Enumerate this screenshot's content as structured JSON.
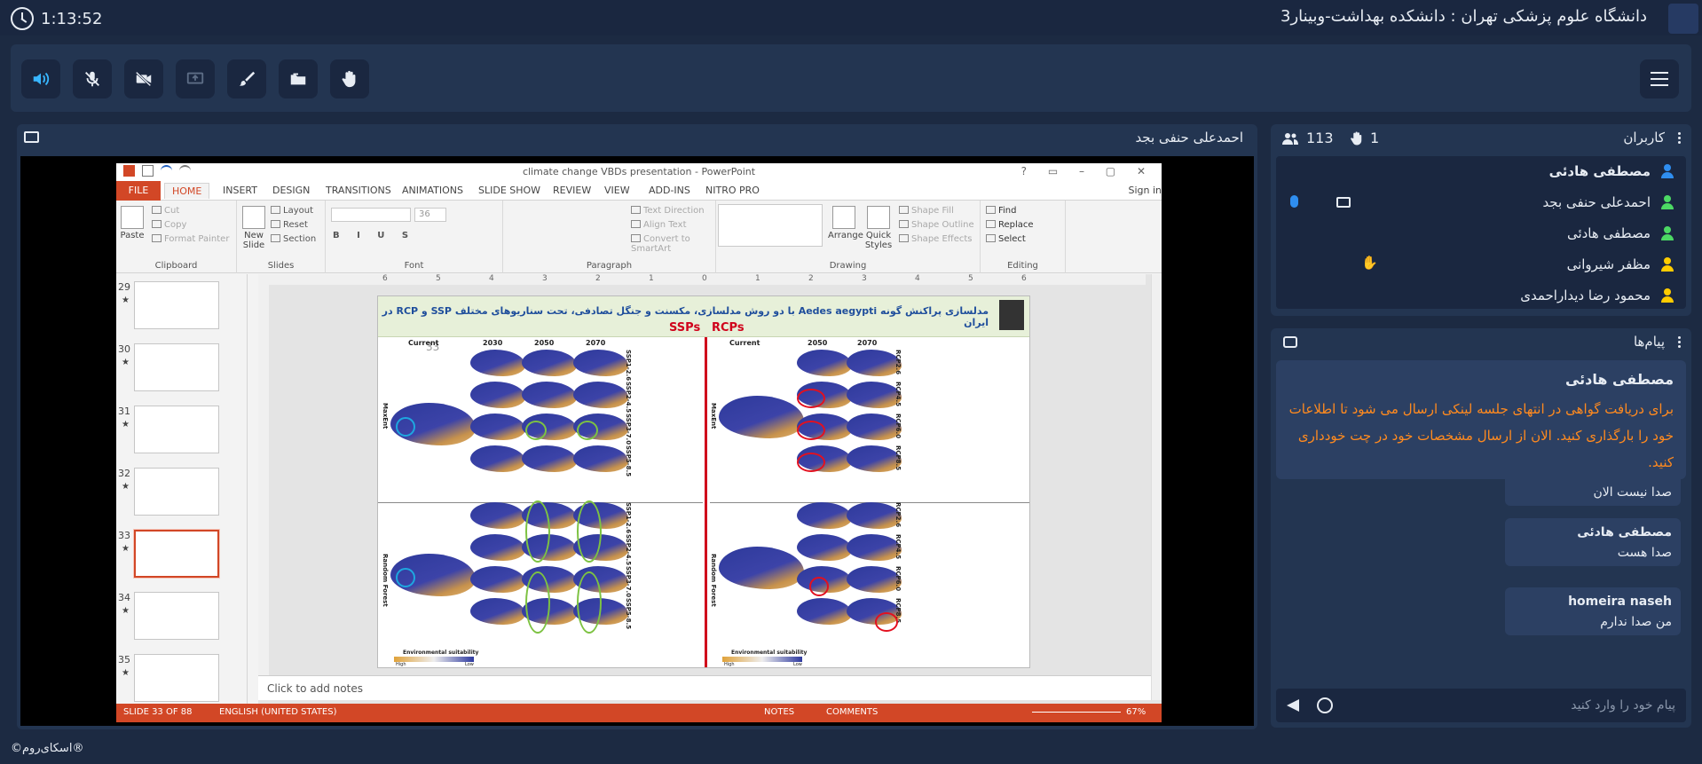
{
  "header": {
    "timer": "1:13:52",
    "room_title": "دانشگاه علوم پزشکی تهران : دانشکده بهداشت-وبینار3"
  },
  "toolbar": {
    "buttons": [
      {
        "icon": "speaker-icon",
        "active": true
      },
      {
        "icon": "mic-off-icon"
      },
      {
        "icon": "camera-off-icon"
      },
      {
        "icon": "screen-share-icon"
      },
      {
        "icon": "brush-icon"
      },
      {
        "icon": "folder-icon"
      },
      {
        "icon": "raise-hand-icon"
      }
    ],
    "menu_icon": "hamburger-icon"
  },
  "presentation": {
    "presenter": "احمدعلی حنفی بجد",
    "ppt": {
      "window_title": "climate change VBDs presentation - PowerPoint",
      "tabs": [
        "FILE",
        "HOME",
        "INSERT",
        "DESIGN",
        "TRANSITIONS",
        "ANIMATIONS",
        "SLIDE SHOW",
        "REVIEW",
        "VIEW",
        "ADD-INS",
        "NITRO PRO"
      ],
      "sign_in": "Sign in",
      "ribbon": {
        "clipboard": {
          "label": "Clipboard",
          "paste": "Paste",
          "cut": "Cut",
          "copy": "Copy",
          "format_painter": "Format Painter"
        },
        "slides": {
          "label": "Slides",
          "new_slide": "New Slide",
          "layout": "Layout",
          "reset": "Reset",
          "section": "Section"
        },
        "font": {
          "label": "Font",
          "size": "36"
        },
        "paragraph": {
          "label": "Paragraph",
          "text_direction": "Text Direction",
          "align_text": "Align Text",
          "convert": "Convert to SmartArt"
        },
        "drawing": {
          "label": "Drawing",
          "arrange": "Arrange",
          "quick_styles": "Quick Styles",
          "shape_fill": "Shape Fill",
          "shape_outline": "Shape Outline",
          "shape_effects": "Shape Effects"
        },
        "editing": {
          "label": "Editing",
          "find": "Find",
          "replace": "Replace",
          "select": "Select"
        }
      },
      "ruler": [
        "6",
        "5",
        "4",
        "3",
        "2",
        "1",
        "0",
        "1",
        "2",
        "3",
        "4",
        "5",
        "6"
      ],
      "thumbnails": [
        {
          "num": "29"
        },
        {
          "num": "30"
        },
        {
          "num": "31"
        },
        {
          "num": "32"
        },
        {
          "num": "33",
          "selected": true
        },
        {
          "num": "34"
        },
        {
          "num": "35"
        }
      ],
      "slide": {
        "title": "مدلسازی پراکنش گونه Aedes aegypti با دو روش مدلسازی، مکسنت و جنگل تصادفی، تحت سناریوهای مختلف SSP و RCP در ایران",
        "ssps": "SSPs",
        "rcps": "RCPs",
        "number_overlay": "33",
        "left_cols": [
          "Current",
          "2030",
          "2050",
          "2070"
        ],
        "right_cols": [
          "Current",
          "2050",
          "2070"
        ],
        "row_models": [
          "MaxEnt",
          "Random Forest"
        ],
        "ssp_labels": [
          "SSP1-2.6",
          "SSP2-4.5",
          "SSP3-7.0",
          "SSP5-8.5"
        ],
        "rcp_labels": [
          "RCP2.6",
          "RCP4.5",
          "RCP6.0",
          "RCP8.5"
        ],
        "legend_title": "Environmental suitability",
        "legend_high": "High",
        "legend_low": "Low"
      },
      "notes_placeholder": "Click to add notes",
      "status": {
        "slide": "SLIDE 33 OF 88",
        "language": "ENGLISH (UNITED STATES)",
        "notes": "NOTES",
        "comments": "COMMENTS",
        "zoom": "67%"
      }
    }
  },
  "users": {
    "title": "کاربران",
    "count": "113",
    "hands": "1",
    "list": [
      {
        "name": "مصطفی هادئی",
        "role": "presenter",
        "bold": true
      },
      {
        "name": "احمدعلی حنفی بجد",
        "role": "participant"
      },
      {
        "name": "مصطفی هادئی",
        "role": "participant"
      },
      {
        "name": "مظفر شیروانی",
        "role": "guest"
      },
      {
        "name": "محمود رضا دیداراحمدی",
        "role": "guest"
      }
    ]
  },
  "messages": {
    "title": "پیام‌ها",
    "pinned": {
      "author": "مصطفی هادئی",
      "text": "برای دریافت گواهی در انتهای جلسه لینکی ارسال می شود تا اطلاعات خود را بارگذاری کنید. الان از ارسال مشخصات خود در چت خودداری کنید."
    },
    "list": [
      {
        "author": "",
        "text": "صدا نیست الان"
      },
      {
        "author": "مصطفی هادئی",
        "text": "صدا هست"
      },
      {
        "author": "homeira naseh",
        "text": "من صدا ندارم"
      }
    ],
    "input_placeholder": "پیام خود را وارد کنید"
  },
  "footer": {
    "brand": "©اسکای‌روم®"
  },
  "colors": {
    "background": "#1c2a42",
    "panel": "#233551",
    "accent_blue": "#38b6ff",
    "pinned_text": "#ff8a1f",
    "ppt_orange": "#d24726"
  }
}
